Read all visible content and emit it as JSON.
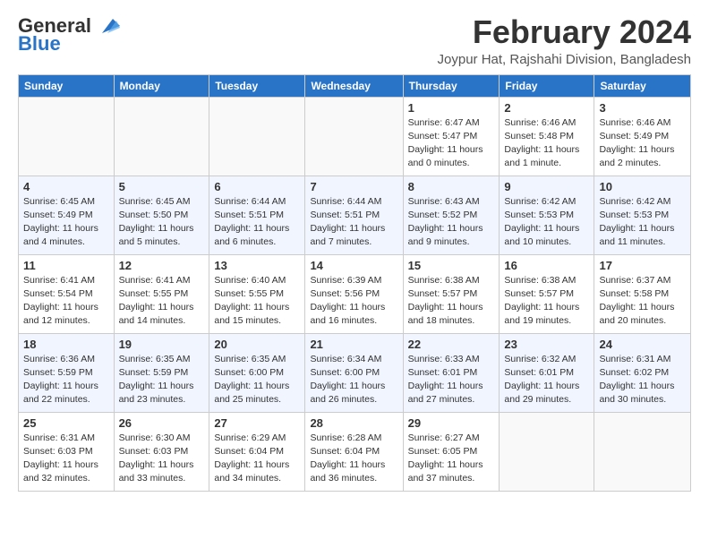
{
  "header": {
    "logo_general": "General",
    "logo_blue": "Blue",
    "month_title": "February 2024",
    "location": "Joypur Hat, Rajshahi Division, Bangladesh"
  },
  "columns": [
    "Sunday",
    "Monday",
    "Tuesday",
    "Wednesday",
    "Thursday",
    "Friday",
    "Saturday"
  ],
  "weeks": [
    [
      {
        "day": "",
        "info": ""
      },
      {
        "day": "",
        "info": ""
      },
      {
        "day": "",
        "info": ""
      },
      {
        "day": "",
        "info": ""
      },
      {
        "day": "1",
        "info": "Sunrise: 6:47 AM\nSunset: 5:47 PM\nDaylight: 11 hours and 0 minutes."
      },
      {
        "day": "2",
        "info": "Sunrise: 6:46 AM\nSunset: 5:48 PM\nDaylight: 11 hours and 1 minute."
      },
      {
        "day": "3",
        "info": "Sunrise: 6:46 AM\nSunset: 5:49 PM\nDaylight: 11 hours and 2 minutes."
      }
    ],
    [
      {
        "day": "4",
        "info": "Sunrise: 6:45 AM\nSunset: 5:49 PM\nDaylight: 11 hours and 4 minutes."
      },
      {
        "day": "5",
        "info": "Sunrise: 6:45 AM\nSunset: 5:50 PM\nDaylight: 11 hours and 5 minutes."
      },
      {
        "day": "6",
        "info": "Sunrise: 6:44 AM\nSunset: 5:51 PM\nDaylight: 11 hours and 6 minutes."
      },
      {
        "day": "7",
        "info": "Sunrise: 6:44 AM\nSunset: 5:51 PM\nDaylight: 11 hours and 7 minutes."
      },
      {
        "day": "8",
        "info": "Sunrise: 6:43 AM\nSunset: 5:52 PM\nDaylight: 11 hours and 9 minutes."
      },
      {
        "day": "9",
        "info": "Sunrise: 6:42 AM\nSunset: 5:53 PM\nDaylight: 11 hours and 10 minutes."
      },
      {
        "day": "10",
        "info": "Sunrise: 6:42 AM\nSunset: 5:53 PM\nDaylight: 11 hours and 11 minutes."
      }
    ],
    [
      {
        "day": "11",
        "info": "Sunrise: 6:41 AM\nSunset: 5:54 PM\nDaylight: 11 hours and 12 minutes."
      },
      {
        "day": "12",
        "info": "Sunrise: 6:41 AM\nSunset: 5:55 PM\nDaylight: 11 hours and 14 minutes."
      },
      {
        "day": "13",
        "info": "Sunrise: 6:40 AM\nSunset: 5:55 PM\nDaylight: 11 hours and 15 minutes."
      },
      {
        "day": "14",
        "info": "Sunrise: 6:39 AM\nSunset: 5:56 PM\nDaylight: 11 hours and 16 minutes."
      },
      {
        "day": "15",
        "info": "Sunrise: 6:38 AM\nSunset: 5:57 PM\nDaylight: 11 hours and 18 minutes."
      },
      {
        "day": "16",
        "info": "Sunrise: 6:38 AM\nSunset: 5:57 PM\nDaylight: 11 hours and 19 minutes."
      },
      {
        "day": "17",
        "info": "Sunrise: 6:37 AM\nSunset: 5:58 PM\nDaylight: 11 hours and 20 minutes."
      }
    ],
    [
      {
        "day": "18",
        "info": "Sunrise: 6:36 AM\nSunset: 5:59 PM\nDaylight: 11 hours and 22 minutes."
      },
      {
        "day": "19",
        "info": "Sunrise: 6:35 AM\nSunset: 5:59 PM\nDaylight: 11 hours and 23 minutes."
      },
      {
        "day": "20",
        "info": "Sunrise: 6:35 AM\nSunset: 6:00 PM\nDaylight: 11 hours and 25 minutes."
      },
      {
        "day": "21",
        "info": "Sunrise: 6:34 AM\nSunset: 6:00 PM\nDaylight: 11 hours and 26 minutes."
      },
      {
        "day": "22",
        "info": "Sunrise: 6:33 AM\nSunset: 6:01 PM\nDaylight: 11 hours and 27 minutes."
      },
      {
        "day": "23",
        "info": "Sunrise: 6:32 AM\nSunset: 6:01 PM\nDaylight: 11 hours and 29 minutes."
      },
      {
        "day": "24",
        "info": "Sunrise: 6:31 AM\nSunset: 6:02 PM\nDaylight: 11 hours and 30 minutes."
      }
    ],
    [
      {
        "day": "25",
        "info": "Sunrise: 6:31 AM\nSunset: 6:03 PM\nDaylight: 11 hours and 32 minutes."
      },
      {
        "day": "26",
        "info": "Sunrise: 6:30 AM\nSunset: 6:03 PM\nDaylight: 11 hours and 33 minutes."
      },
      {
        "day": "27",
        "info": "Sunrise: 6:29 AM\nSunset: 6:04 PM\nDaylight: 11 hours and 34 minutes."
      },
      {
        "day": "28",
        "info": "Sunrise: 6:28 AM\nSunset: 6:04 PM\nDaylight: 11 hours and 36 minutes."
      },
      {
        "day": "29",
        "info": "Sunrise: 6:27 AM\nSunset: 6:05 PM\nDaylight: 11 hours and 37 minutes."
      },
      {
        "day": "",
        "info": ""
      },
      {
        "day": "",
        "info": ""
      }
    ]
  ]
}
